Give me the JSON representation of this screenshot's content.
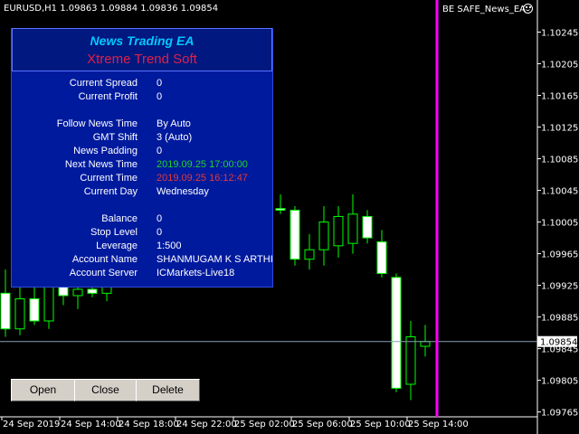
{
  "header": {
    "symbol_info": "EURUSD,H1  1.09863 1.09884 1.09836 1.09854",
    "ea_name": "BE SAFE_News_EA",
    "smiley_icon": "smiley-face-icon"
  },
  "panel": {
    "title": "News Trading EA",
    "subtitle": "Xtreme Trend Soft",
    "title_color": "#00c8ff",
    "subtitle_color": "#e0204a",
    "rows": [
      {
        "label": "Current Spread",
        "value": "0"
      },
      {
        "label": "Current Profit",
        "value": "0"
      },
      {
        "label": "Follow News Time",
        "value": "By Auto"
      },
      {
        "label": "GMT Shift",
        "value": "3 (Auto)"
      },
      {
        "label": "News Padding",
        "value": "0"
      },
      {
        "label": "Next News Time",
        "value": "2019.09.25 17:00:00",
        "color": "#21d321"
      },
      {
        "label": "Current Time",
        "value": "2019.09.25 16:12:47",
        "color": "#e03a3a"
      },
      {
        "label": "Current Day",
        "value": "Wednesday"
      },
      {
        "label": "Balance",
        "value": "0"
      },
      {
        "label": "Stop Level",
        "value": "0"
      },
      {
        "label": "Leverage",
        "value": "1:500"
      },
      {
        "label": "Account Name",
        "value": "SHANMUGAM K S ARTHI"
      },
      {
        "label": "Account Server",
        "value": "ICMarkets-Live18"
      }
    ]
  },
  "buttons": {
    "open": "Open",
    "close": "Close",
    "delete": "Delete"
  },
  "chart_data": {
    "type": "candlestick",
    "symbol": "EURUSD",
    "timeframe": "H1",
    "current_price": "1.09854",
    "y_ticks": [
      "1.10245",
      "1.10205",
      "1.10165",
      "1.10125",
      "1.10085",
      "1.10045",
      "1.10005",
      "1.09965",
      "1.09925",
      "1.09885",
      "1.09845",
      "1.09805",
      "1.09765"
    ],
    "x_ticks": [
      "24 Sep 2019",
      "24 Sep 14:00",
      "24 Sep 18:00",
      "24 Sep 22:00",
      "25 Sep 02:00",
      "25 Sep 06:00",
      "25 Sep 10:00",
      "25 Sep 14:00"
    ],
    "ylim": [
      1.0976,
      1.10265
    ],
    "colors": {
      "bull_body": "#000000",
      "bear_body": "#ffffff",
      "wick": "#00ff00",
      "vline": "#ff00ff",
      "price_line": "#8aa0b4"
    },
    "vertical_line_after_candle": 29,
    "candles": [
      {
        "o": 1.09915,
        "h": 1.09945,
        "l": 1.0986,
        "c": 1.0987
      },
      {
        "o": 1.0987,
        "h": 1.09925,
        "l": 1.09862,
        "c": 1.09908
      },
      {
        "o": 1.09908,
        "h": 1.0994,
        "l": 1.09875,
        "c": 1.0988
      },
      {
        "o": 1.0988,
        "h": 1.09935,
        "l": 1.0987,
        "c": 1.09925
      },
      {
        "o": 1.09925,
        "h": 1.09955,
        "l": 1.099,
        "c": 1.09912
      },
      {
        "o": 1.09912,
        "h": 1.0993,
        "l": 1.09895,
        "c": 1.0992
      },
      {
        "o": 1.0992,
        "h": 1.0995,
        "l": 1.0991,
        "c": 1.09915
      },
      {
        "o": 1.09915,
        "h": 1.09965,
        "l": 1.09905,
        "c": 1.09948
      },
      {
        "o": 1.09948,
        "h": 1.09975,
        "l": 1.0993,
        "c": 1.09955
      },
      {
        "o": 1.09955,
        "h": 1.0999,
        "l": 1.0994,
        "c": 1.0995
      },
      {
        "o": 1.0995,
        "h": 1.09985,
        "l": 1.09935,
        "c": 1.09975
      },
      {
        "o": 1.09975,
        "h": 1.10005,
        "l": 1.0996,
        "c": 1.09985
      },
      {
        "o": 1.09985,
        "h": 1.1001,
        "l": 1.0997,
        "c": 1.0999
      },
      {
        "o": 1.0999,
        "h": 1.1002,
        "l": 1.09975,
        "c": 1.1
      },
      {
        "o": 1.1,
        "h": 1.10025,
        "l": 1.09985,
        "c": 1.1001
      },
      {
        "o": 1.1001,
        "h": 1.1003,
        "l": 1.09995,
        "c": 1.10008
      },
      {
        "o": 1.10008,
        "h": 1.1004,
        "l": 1.1,
        "c": 1.1003
      },
      {
        "o": 1.1003,
        "h": 1.10045,
        "l": 1.1001,
        "c": 1.10025
      },
      {
        "o": 1.10025,
        "h": 1.1004,
        "l": 1.10012,
        "c": 1.10022
      },
      {
        "o": 1.10022,
        "h": 1.1004,
        "l": 1.10015,
        "c": 1.1002
      },
      {
        "o": 1.1002,
        "h": 1.10025,
        "l": 1.0995,
        "c": 1.09958
      },
      {
        "o": 1.09958,
        "h": 1.0999,
        "l": 1.09945,
        "c": 1.0997
      },
      {
        "o": 1.0997,
        "h": 1.10025,
        "l": 1.0995,
        "c": 1.10005
      },
      {
        "o": 1.09975,
        "h": 1.10025,
        "l": 1.0996,
        "c": 1.10012
      },
      {
        "o": 1.09978,
        "h": 1.1004,
        "l": 1.09965,
        "c": 1.10015
      },
      {
        "o": 1.10012,
        "h": 1.1002,
        "l": 1.09978,
        "c": 1.09985
      },
      {
        "o": 1.0998,
        "h": 1.09995,
        "l": 1.09935,
        "c": 1.0994
      },
      {
        "o": 1.09935,
        "h": 1.0994,
        "l": 1.0979,
        "c": 1.09795
      },
      {
        "o": 1.098,
        "h": 1.0988,
        "l": 1.0978,
        "c": 1.0986
      },
      {
        "o": 1.09848,
        "h": 1.09875,
        "l": 1.09835,
        "c": 1.09854
      }
    ]
  }
}
